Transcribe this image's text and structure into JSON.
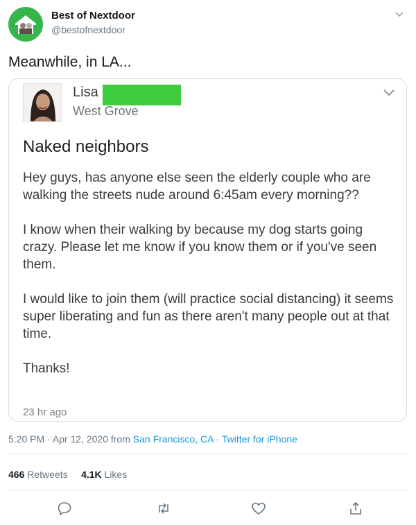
{
  "account": {
    "name": "Best of Nextdoor",
    "handle": "@bestofnextdoor"
  },
  "tweet": {
    "text": "Meanwhile, in LA..."
  },
  "post": {
    "author_first": "Lisa",
    "neighborhood": "West Grove",
    "title": "Naked neighbors",
    "paragraphs": [
      "Hey guys, has anyone else seen the elderly couple who are walking the streets nude around 6:45am every morning??",
      "I know when their walking by because my dog starts going crazy. Please let me know if you know them or if you've seen them.",
      "I would like to join them (will practice social distancing) it seems super liberating and fun as there aren't many people out at that time.",
      "Thanks!"
    ],
    "time": "23 hr ago",
    "redaction_color": "#3ccc3c"
  },
  "meta": {
    "time": "5:20 PM",
    "sep1": " · ",
    "date": "Apr 12, 2020",
    "from": " from ",
    "location": "San Francisco, CA",
    "sep2": " · ",
    "client": "Twitter for iPhone"
  },
  "stats": {
    "retweets_count": "466",
    "retweets_label": "Retweets",
    "likes_count": "4.1K",
    "likes_label": "Likes"
  },
  "actions": [
    "reply-icon",
    "retweet-icon",
    "like-icon",
    "share-icon"
  ],
  "colors": {
    "link": "#1b95e0",
    "secondary": "#657786",
    "brand_green": "#35b54a"
  }
}
